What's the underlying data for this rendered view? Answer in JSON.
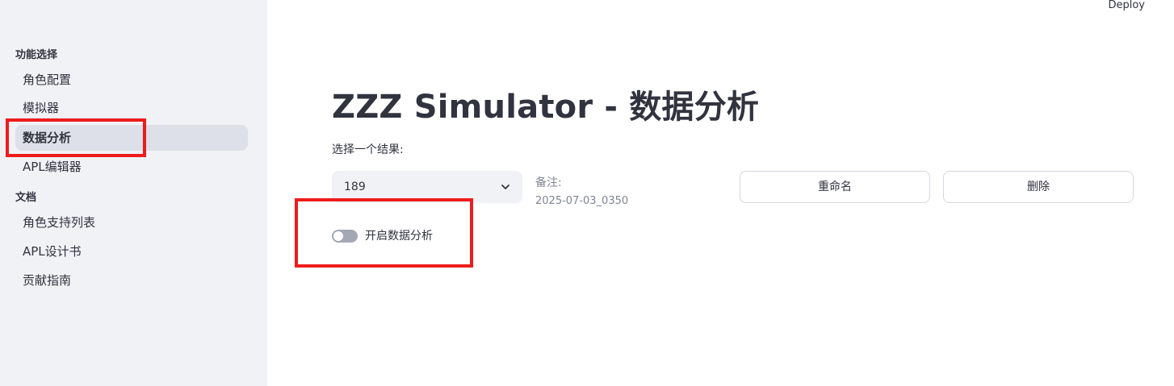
{
  "sidebar": {
    "sections": [
      {
        "label": "功能选择",
        "items": [
          {
            "label": "角色配置",
            "active": false
          },
          {
            "label": "模拟器",
            "active": false
          },
          {
            "label": "数据分析",
            "active": true
          },
          {
            "label": "APL编辑器",
            "active": false
          }
        ]
      },
      {
        "label": "文档",
        "items": [
          {
            "label": "角色支持列表",
            "active": false
          },
          {
            "label": "APL设计书",
            "active": false
          },
          {
            "label": "贡献指南",
            "active": false
          }
        ]
      }
    ]
  },
  "header": {
    "deploy_label": "Deploy"
  },
  "main": {
    "title": "ZZZ Simulator - 数据分析",
    "result_select": {
      "label": "选择一个结果:",
      "value": "189"
    },
    "note": {
      "label": "备注:",
      "value": "2025-07-03_0350"
    },
    "rename_button": "重命名",
    "delete_button": "删除",
    "analysis_toggle": {
      "label": "开启数据分析",
      "checked": false
    }
  },
  "colors": {
    "sidebar_bg": "#f0f2f6",
    "highlight": "#ee1c1c",
    "text": "#31333f"
  }
}
